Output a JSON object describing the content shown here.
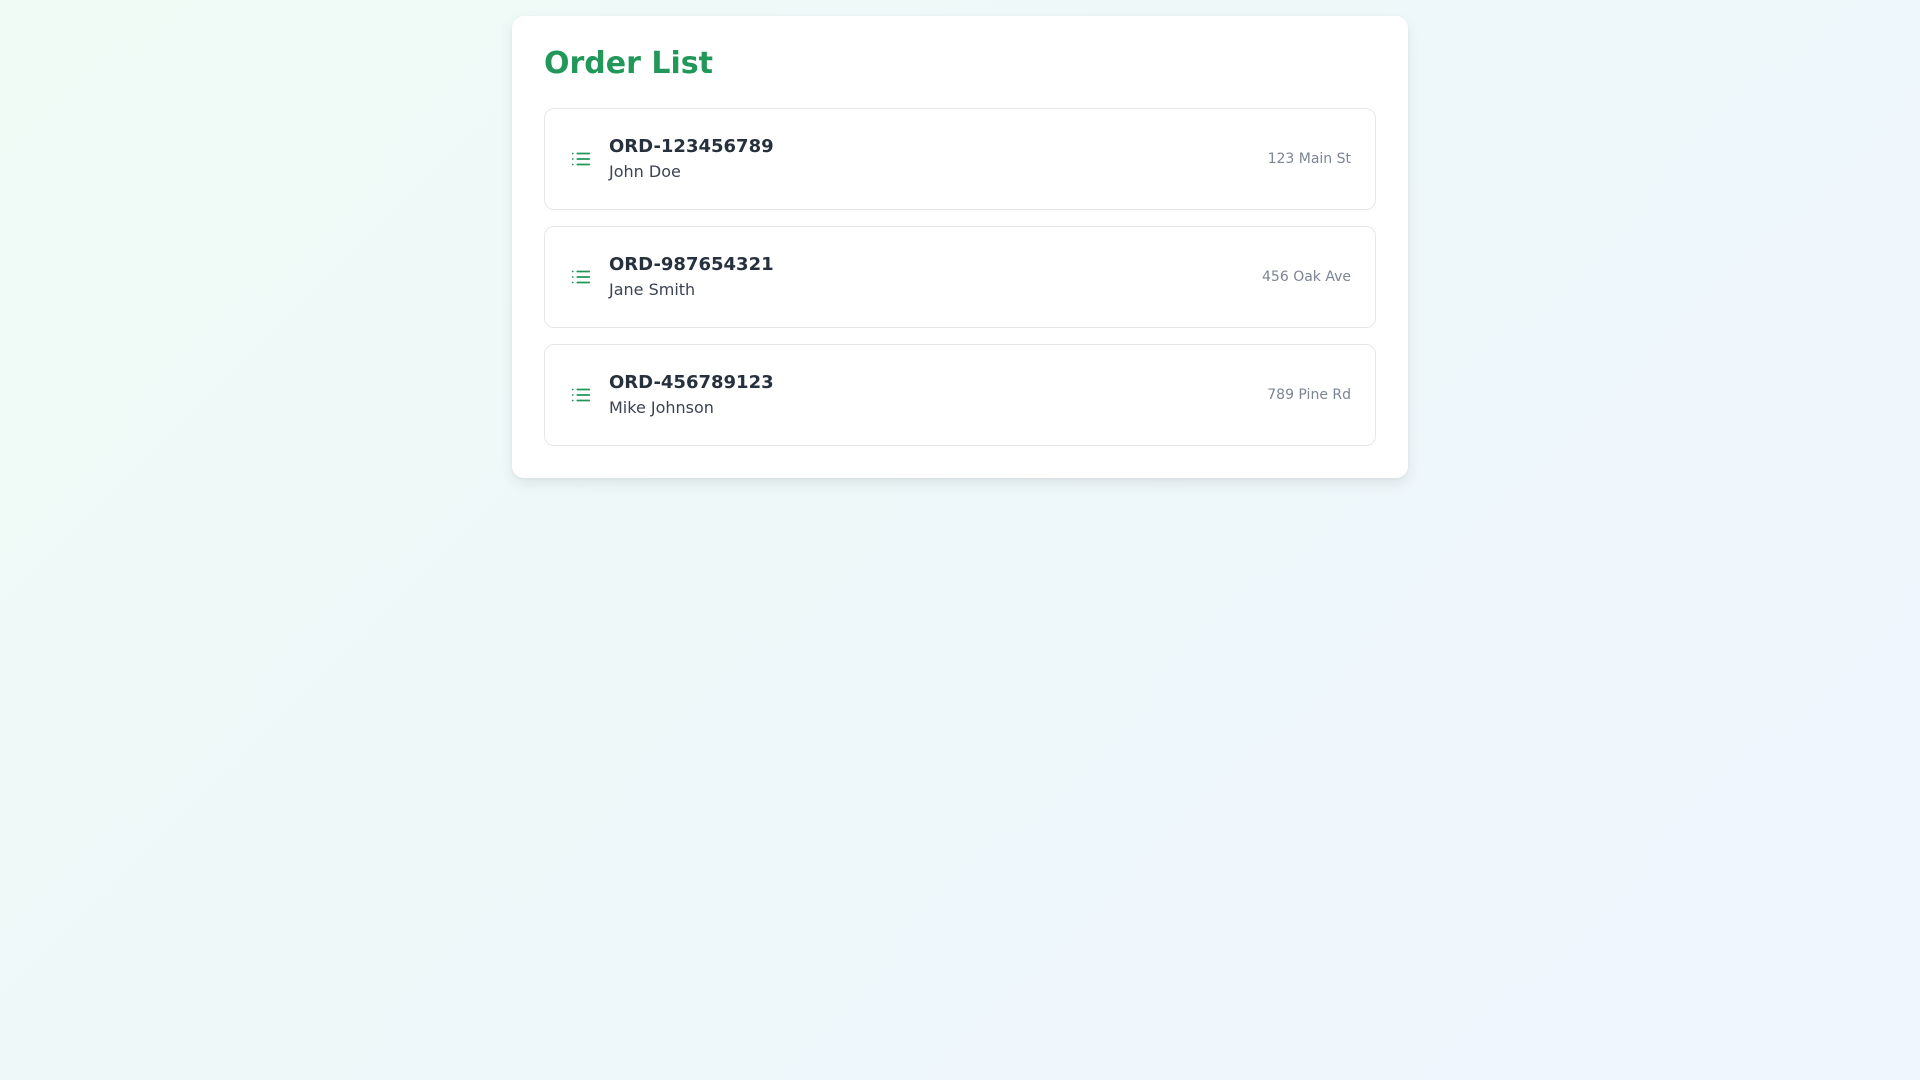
{
  "title": "Order List",
  "accent_color": "#22975a",
  "list_icon": "list-icon",
  "orders": [
    {
      "id": "ORD-123456789",
      "customer": "John Doe",
      "address": "123 Main St"
    },
    {
      "id": "ORD-987654321",
      "customer": "Jane Smith",
      "address": "456 Oak Ave"
    },
    {
      "id": "ORD-456789123",
      "customer": "Mike Johnson",
      "address": "789 Pine Rd"
    }
  ]
}
